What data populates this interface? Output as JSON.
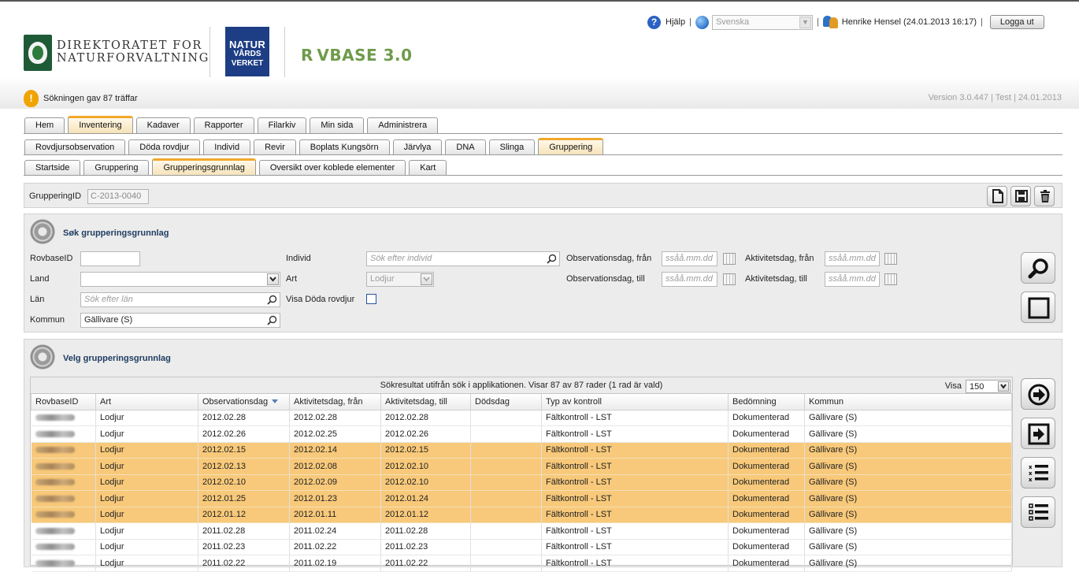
{
  "header": {
    "org1_line1": "DIREKTORATET FOR",
    "org1_line2": "NATURFORVALTNING",
    "org2_line1": "NATUR",
    "org2_line2": "VÅRDS",
    "org2_line3": "VERKET",
    "app_name": "R VBASE 3.0",
    "help_label": "Hjälp",
    "language_value": "Svenska",
    "user_info": "Henrike Hensel (24.01.2013 16:17)",
    "logout_label": "Logga ut",
    "search_message": "Sökningen gav 87 träffar",
    "version_text": "Version 3.0.447 | Test | 24.01.2013"
  },
  "main_tabs": [
    "Hem",
    "Inventering",
    "Kadaver",
    "Rapporter",
    "Filarkiv",
    "Min sida",
    "Administrera"
  ],
  "main_tab_active": "Inventering",
  "sub_tabs": [
    "Rovdjursobservation",
    "Döda rovdjur",
    "Individ",
    "Revir",
    "Boplats Kungsörn",
    "Järvlya",
    "DNA",
    "Slinga",
    "Gruppering"
  ],
  "sub_tab_active": "Gruppering",
  "sub_sub_tabs": [
    "Startside",
    "Gruppering",
    "Grupperingsgrunnlag",
    "Oversikt over koblede elementer",
    "Kart"
  ],
  "sub_sub_tab_active": "Grupperingsgrunnlag",
  "id_bar": {
    "label": "GrupperingID",
    "value": "C-2013-0040"
  },
  "search_panel": {
    "title": "Søk grupperingsgrunnlag",
    "rovbaseid_label": "RovbaseID",
    "rovbaseid_value": "",
    "land_label": "Land",
    "land_value": "",
    "lan_label": "Län",
    "lan_placeholder": "Sök efter län",
    "kommun_label": "Kommun",
    "kommun_value": "Gällivare (S)",
    "individ_label": "Individ",
    "individ_placeholder": "Sök efter individ",
    "art_label": "Art",
    "art_value": "Lodjur",
    "visa_doda_label": "Visa Döda rovdjur",
    "obs_fran_label": "Observationsdag, från",
    "obs_till_label": "Observationsdag, till",
    "akt_fran_label": "Aktivitetsdag, från",
    "akt_till_label": "Aktivitetsdag, till",
    "date_placeholder": "ssåå.mm.dd"
  },
  "results_panel": {
    "title": "Velg grupperingsgrunnlag",
    "info": "Sökresultat utifrån sök i applikationen. Visar 87 av 87 rader (1 rad är vald)",
    "visa_label": "Visa",
    "visa_value": "150",
    "columns": [
      "RovbaseID",
      "Art",
      "Observationsdag",
      "Aktivitetsdag, från",
      "Aktivitetsdag, till",
      "Dödsdag",
      "Typ av kontroll",
      "Bedömning",
      "Kommun"
    ],
    "rows": [
      {
        "art": "Lodjur",
        "obs": "2012.02.28",
        "fran": "2012.02.28",
        "till": "2012.02.28",
        "dod": "",
        "typ": "Fältkontroll - LST",
        "bed": "Dokumenterad",
        "kommun": "Gällivare (S)",
        "selected": false
      },
      {
        "art": "Lodjur",
        "obs": "2012.02.26",
        "fran": "2012.02.25",
        "till": "2012.02.26",
        "dod": "",
        "typ": "Fältkontroll - LST",
        "bed": "Dokumenterad",
        "kommun": "Gällivare (S)",
        "selected": false
      },
      {
        "art": "Lodjur",
        "obs": "2012.02.15",
        "fran": "2012.02.14",
        "till": "2012.02.15",
        "dod": "",
        "typ": "Fältkontroll - LST",
        "bed": "Dokumenterad",
        "kommun": "Gällivare (S)",
        "selected": true
      },
      {
        "art": "Lodjur",
        "obs": "2012.02.13",
        "fran": "2012.02.08",
        "till": "2012.02.10",
        "dod": "",
        "typ": "Fältkontroll - LST",
        "bed": "Dokumenterad",
        "kommun": "Gällivare (S)",
        "selected": true
      },
      {
        "art": "Lodjur",
        "obs": "2012.02.10",
        "fran": "2012.02.09",
        "till": "2012.02.10",
        "dod": "",
        "typ": "Fältkontroll - LST",
        "bed": "Dokumenterad",
        "kommun": "Gällivare (S)",
        "selected": true
      },
      {
        "art": "Lodjur",
        "obs": "2012.01.25",
        "fran": "2012.01.23",
        "till": "2012.01.24",
        "dod": "",
        "typ": "Fältkontroll - LST",
        "bed": "Dokumenterad",
        "kommun": "Gällivare (S)",
        "selected": true
      },
      {
        "art": "Lodjur",
        "obs": "2012.01.12",
        "fran": "2012.01.11",
        "till": "2012.01.12",
        "dod": "",
        "typ": "Fältkontroll - LST",
        "bed": "Dokumenterad",
        "kommun": "Gällivare (S)",
        "selected": true
      },
      {
        "art": "Lodjur",
        "obs": "2011.02.28",
        "fran": "2011.02.24",
        "till": "2011.02.28",
        "dod": "",
        "typ": "Fältkontroll - LST",
        "bed": "Dokumenterad",
        "kommun": "Gällivare (S)",
        "selected": false
      },
      {
        "art": "Lodjur",
        "obs": "2011.02.23",
        "fran": "2011.02.22",
        "till": "2011.02.23",
        "dod": "",
        "typ": "Fältkontroll - LST",
        "bed": "Dokumenterad",
        "kommun": "Gällivare (S)",
        "selected": false
      },
      {
        "art": "Lodjur",
        "obs": "2011.02.22",
        "fran": "2011.02.19",
        "till": "2011.02.22",
        "dod": "",
        "typ": "Fältkontroll - LST",
        "bed": "Dokumenterad",
        "kommun": "Gällivare (S)",
        "selected": false
      }
    ]
  },
  "colors": {
    "active_tab_accent": "#f0a82a",
    "selected_row": "#f8c97a",
    "section_title": "#1f3d62",
    "logo_green": "#1f5a36",
    "logo_blue": "#1d3e84",
    "rovbase_green": "#6f9b4b"
  },
  "icons": {
    "help": "help-icon",
    "language": "globe-icon",
    "user": "users-icon",
    "warning": "warning-icon",
    "new": "new-document-icon",
    "save": "save-icon",
    "delete": "trash-icon",
    "search": "magnifier-icon",
    "clear": "clear-square-icon",
    "add": "arrow-circle-right-icon",
    "add_selected": "arrow-box-right-icon",
    "list1": "numbered-list-icon",
    "list2": "list-icon"
  }
}
